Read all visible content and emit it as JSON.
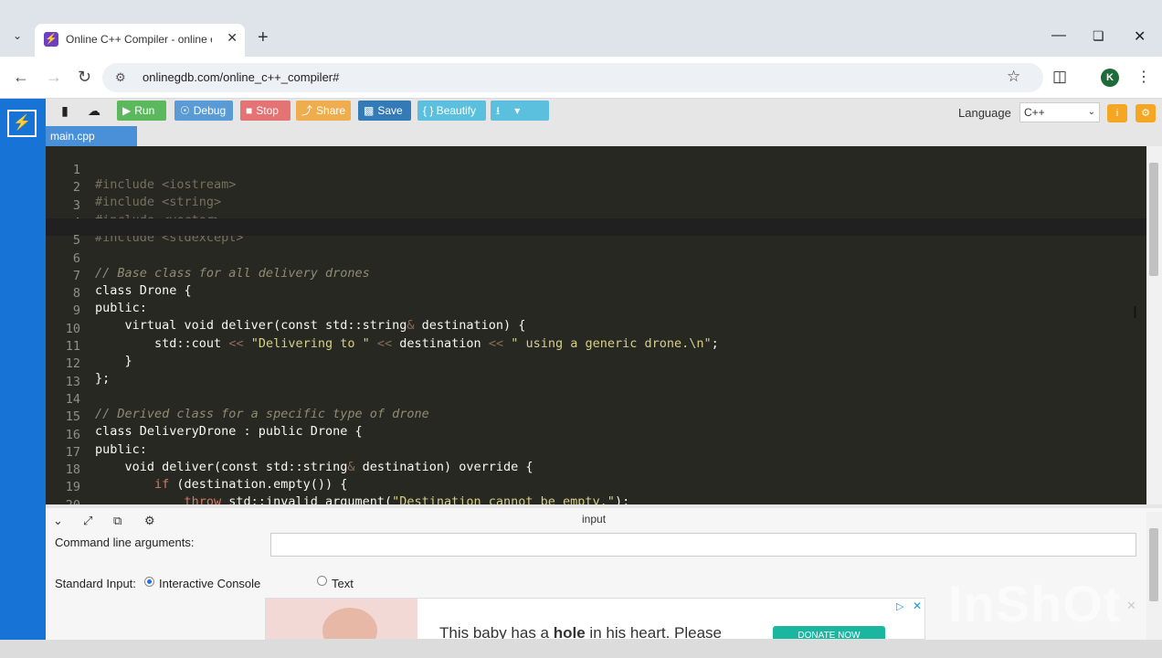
{
  "browser": {
    "tab_title": "Online C++ Compiler - online e",
    "tab_close": "✕",
    "new_tab": "+",
    "url": "onlinegdb.com/online_c++_compiler#",
    "profile_initial": "K"
  },
  "ide_toolbar": {
    "run": "Run",
    "debug": "Debug",
    "stop": "Stop",
    "share": "Share",
    "save": "Save",
    "beautify": "{ } Beautify",
    "language_label": "Language",
    "language_value": "C++"
  },
  "file_tab": "main.cpp",
  "editor": {
    "lines": [
      {
        "n": "1"
      },
      {
        "n": "2"
      },
      {
        "n": "3"
      },
      {
        "n": "4"
      },
      {
        "n": "5"
      },
      {
        "n": "6"
      },
      {
        "n": "7"
      },
      {
        "n": "8"
      },
      {
        "n": "9"
      },
      {
        "n": "10"
      },
      {
        "n": "11"
      },
      {
        "n": "12"
      },
      {
        "n": "13"
      },
      {
        "n": "14"
      },
      {
        "n": "15"
      },
      {
        "n": "16"
      },
      {
        "n": "17"
      },
      {
        "n": "18"
      },
      {
        "n": "19"
      },
      {
        "n": "20"
      }
    ],
    "code": {
      "l1a": "#include",
      "l1b": " <iostream>",
      "l2a": "#include",
      "l2b": " <string>",
      "l3a": "#include",
      "l3b": " <vector>",
      "l4a": "#include",
      "l4b": " <stdexcept>",
      "l6": "// Base class for all delivery drones",
      "l7": "class Drone {",
      "l8": "public:",
      "l9a": "    virtual void deliver(const std::string",
      "l9b": "&",
      "l9c": " destination) {",
      "l10a": "        std::cout ",
      "l10b": "<<",
      "l10c": " \"Delivering to \" ",
      "l10d": "<<",
      "l10e": " destination ",
      "l10f": "<<",
      "l10g": " \" using a generic drone.\\n\"",
      "l10h": ";",
      "l11": "    }",
      "l12": "};",
      "l14": "// Derived class for a specific type of drone",
      "l15": "class DeliveryDrone : public Drone {",
      "l16": "public:",
      "l17a": "    void deliver(const std::string",
      "l17b": "&",
      "l17c": " destination) override {",
      "l18a": "        if",
      "l18b": " (destination.empty()) {",
      "l19a": "            throw",
      "l19b": " std::invalid_argument(",
      "l19c": "\"Destination cannot be empty.\"",
      "l19d": ");",
      "l20": "        }"
    }
  },
  "io": {
    "title": "input",
    "cla_label": "Command line arguments:",
    "stdin_label": "Standard Input:",
    "opt_console": "Interactive Console",
    "opt_text": "Text"
  },
  "ad": {
    "text_pre": "This baby has a ",
    "text_bold": "hole",
    "text_post": " in his heart. Please",
    "button": "DONATE NOW"
  },
  "watermark": "InShOt",
  "colors": {
    "sidebar": "#1773d5",
    "run": "#5cb85c",
    "debug": "#5b9bd5",
    "stop": "#e57373",
    "share": "#f0ad4e",
    "save": "#337ab7",
    "beautify": "#5bc0de",
    "editor_bg": "#272822"
  }
}
